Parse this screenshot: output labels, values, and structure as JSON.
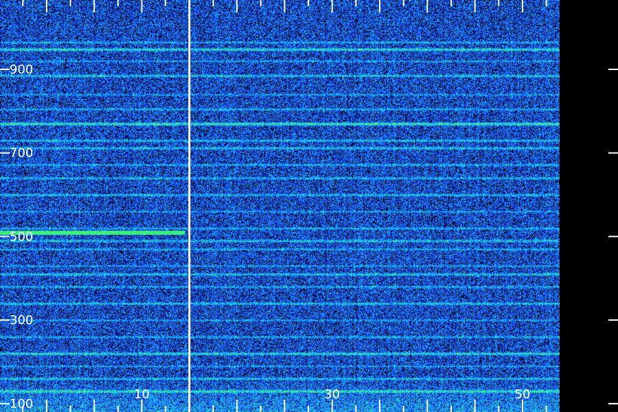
{
  "chart_data": {
    "type": "heatmap",
    "title": "",
    "xlabel": "",
    "ylabel": "",
    "x_ticks": [
      10,
      30,
      50
    ],
    "y_ticks": [
      100,
      300,
      500,
      700,
      900
    ],
    "y_tick_labels": [
      "100",
      "300",
      "500",
      "700",
      "900"
    ],
    "x_tick_labels": [
      "10",
      "30",
      "50"
    ],
    "xlim": [
      -4.9,
      53.9
    ],
    "ylim": [
      80,
      1066
    ],
    "marker_x": 15,
    "grid": false,
    "colormap": [
      "#000000",
      "#0a1fb8",
      "#1e5bff",
      "#1fa8ff",
      "#22e0e0",
      "#37f07a",
      "#7cff3a"
    ],
    "intensity_bands": [
      {
        "y": 965,
        "level": 0.55
      },
      {
        "y": 948,
        "level": 0.72
      },
      {
        "y": 920,
        "level": 0.5
      },
      {
        "y": 885,
        "level": 0.62
      },
      {
        "y": 840,
        "level": 0.5
      },
      {
        "y": 805,
        "level": 0.55
      },
      {
        "y": 770,
        "level": 0.78
      },
      {
        "y": 730,
        "level": 0.6
      },
      {
        "y": 712,
        "level": 0.62
      },
      {
        "y": 672,
        "level": 0.55
      },
      {
        "y": 640,
        "level": 0.58
      },
      {
        "y": 600,
        "level": 0.6
      },
      {
        "y": 560,
        "level": 0.5
      },
      {
        "y": 520,
        "level": 0.55
      },
      {
        "y": 490,
        "level": 0.62
      },
      {
        "y": 470,
        "level": 0.55
      },
      {
        "y": 430,
        "level": 0.5
      },
      {
        "y": 410,
        "level": 0.62
      },
      {
        "y": 380,
        "level": 0.55
      },
      {
        "y": 340,
        "level": 0.62
      },
      {
        "y": 300,
        "level": 0.5
      },
      {
        "y": 260,
        "level": 0.55
      },
      {
        "y": 220,
        "level": 0.7
      },
      {
        "y": 190,
        "level": 0.5
      },
      {
        "y": 160,
        "level": 0.62
      },
      {
        "y": 130,
        "level": 0.7
      }
    ],
    "hot_segments": [
      {
        "x": [
          -4.9,
          14.5
        ],
        "y": 510,
        "level": 0.9
      }
    ]
  }
}
